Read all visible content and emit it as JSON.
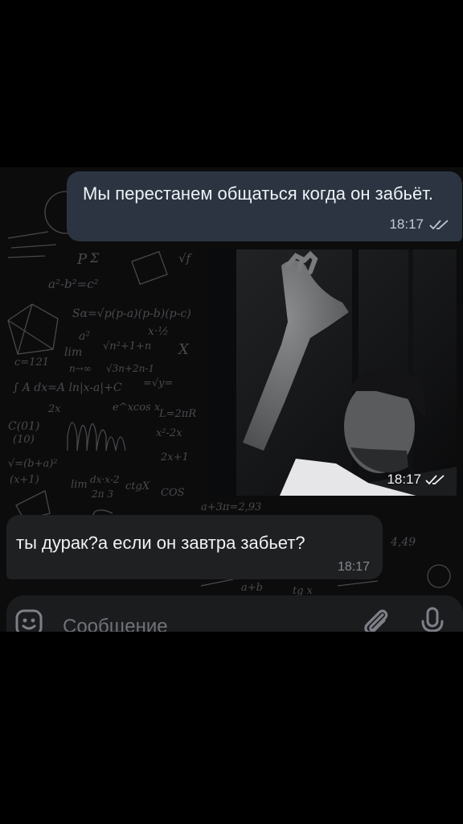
{
  "messages": {
    "outgoing": {
      "text": "Мы перестанем общаться когда он забьёт.",
      "time": "18:17",
      "status_icon": "double-check-icon"
    },
    "media": {
      "time": "18:17",
      "status_icon": "double-check-icon"
    },
    "incoming": {
      "text": "ты дурак?а если он завтра забьет?",
      "time": "18:17"
    }
  },
  "composer": {
    "placeholder": "Сообщение",
    "value": "",
    "emoji_icon": "emoji-icon",
    "attach_icon": "paperclip-icon",
    "mic_icon": "microphone-icon"
  },
  "theme": {
    "outgoing_bubble": "#2b3440",
    "incoming_bubble": "#1f2022",
    "background": "#0c0c0d"
  }
}
